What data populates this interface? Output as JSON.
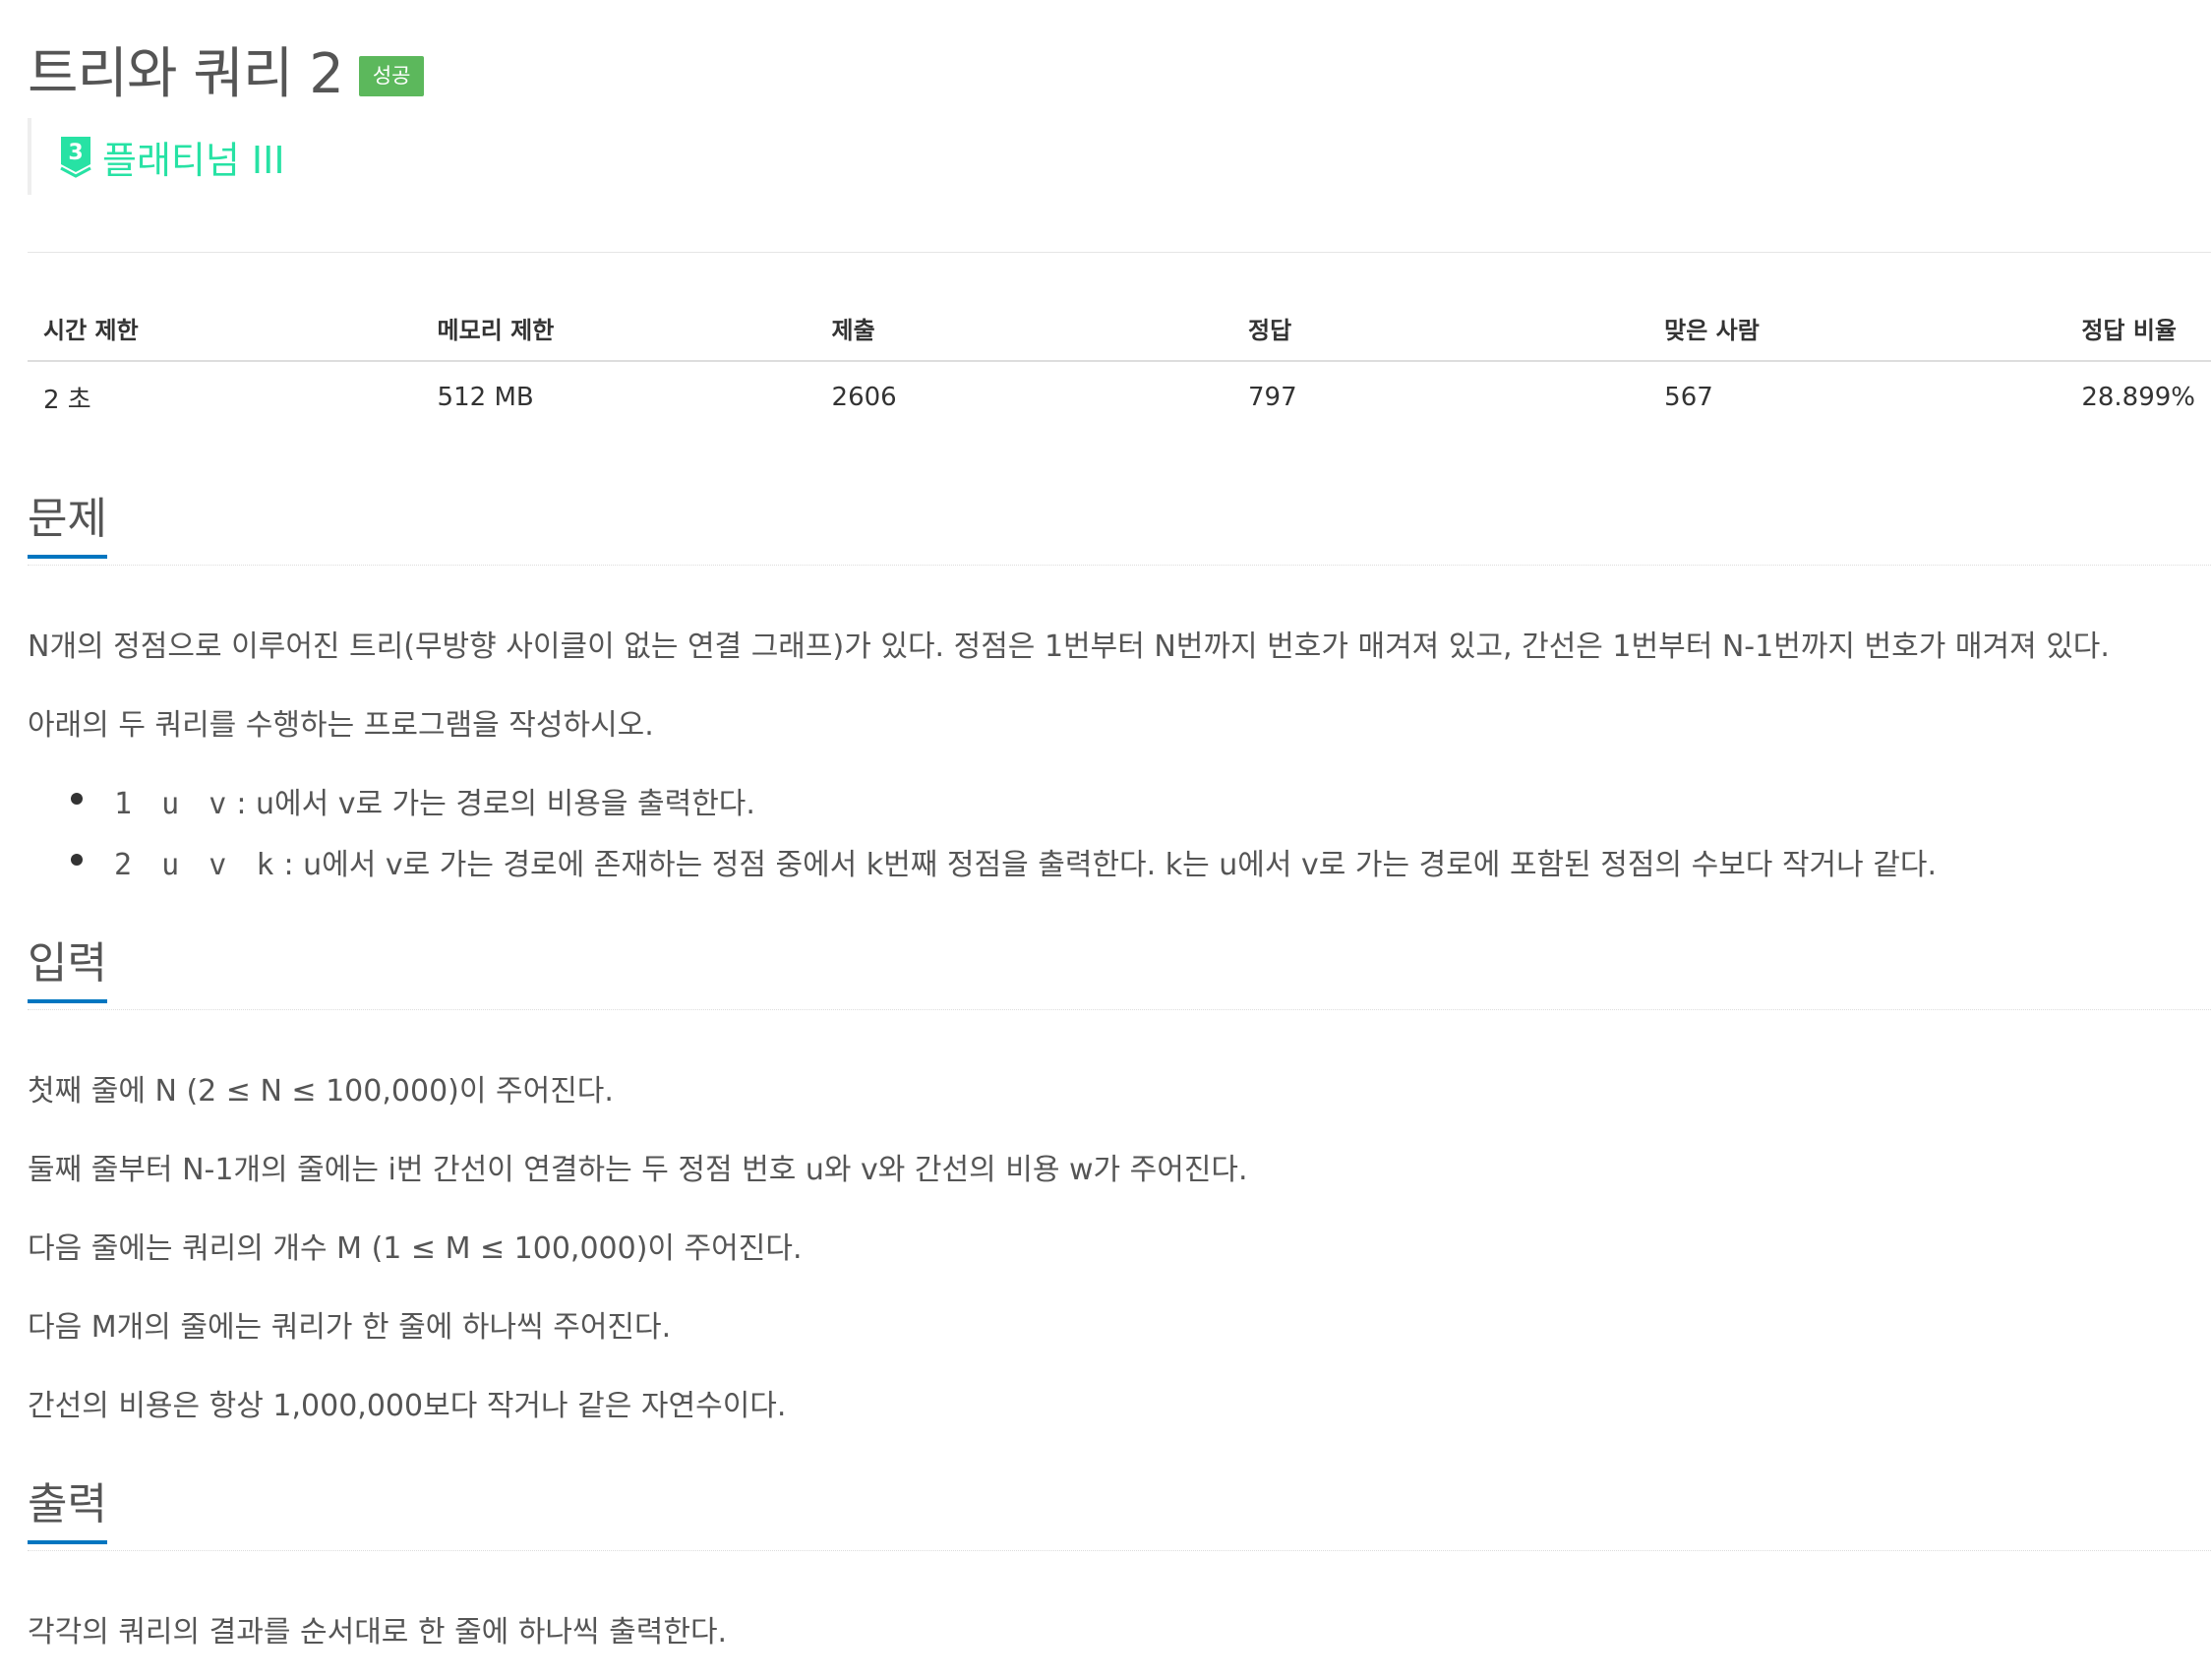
{
  "header": {
    "title": "트리와 쿼리 2",
    "status_badge": "성공",
    "tier": {
      "number": "3",
      "label": "플래티넘 III",
      "color": "#27e2a4"
    }
  },
  "info_table": {
    "headers": [
      "시간 제한",
      "메모리 제한",
      "제출",
      "정답",
      "맞은 사람",
      "정답 비율"
    ],
    "values": [
      "2 초",
      "512 MB",
      "2606",
      "797",
      "567",
      "28.899%"
    ]
  },
  "sections": {
    "problem": {
      "title": "문제",
      "paragraphs": [
        "N개의 정점으로 이루어진 트리(무방향 사이클이 없는 연결 그래프)가 있다. 정점은 1번부터 N번까지 번호가 매겨져 있고, 간선은 1번부터 N-1번까지 번호가 매겨져 있다.",
        "아래의 두 쿼리를 수행하는 프로그램을 작성하시오."
      ],
      "queries": [
        {
          "code": "1 u v",
          "text": ": u에서 v로 가는 경로의 비용을 출력한다."
        },
        {
          "code": "2 u v k",
          "text": ": u에서 v로 가는 경로에 존재하는 정점 중에서 k번째 정점을 출력한다. k는 u에서 v로 가는 경로에 포함된 정점의 수보다 작거나 같다."
        }
      ]
    },
    "input": {
      "title": "입력",
      "paragraphs": [
        "첫째 줄에 N (2 ≤ N ≤ 100,000)이 주어진다.",
        "둘째 줄부터 N-1개의 줄에는 i번 간선이 연결하는 두 정점 번호 u와 v와 간선의 비용 w가 주어진다.",
        "다음 줄에는 쿼리의 개수 M (1 ≤ M ≤ 100,000)이 주어진다.",
        "다음 M개의 줄에는 쿼리가 한 줄에 하나씩 주어진다.",
        "간선의 비용은 항상 1,000,000보다 작거나 같은 자연수이다."
      ]
    },
    "output": {
      "title": "출력",
      "paragraphs": [
        "각각의 쿼리의 결과를 순서대로 한 줄에 하나씩 출력한다."
      ]
    }
  },
  "colors": {
    "success": "#5cb85c",
    "accent": "#0076c0"
  }
}
